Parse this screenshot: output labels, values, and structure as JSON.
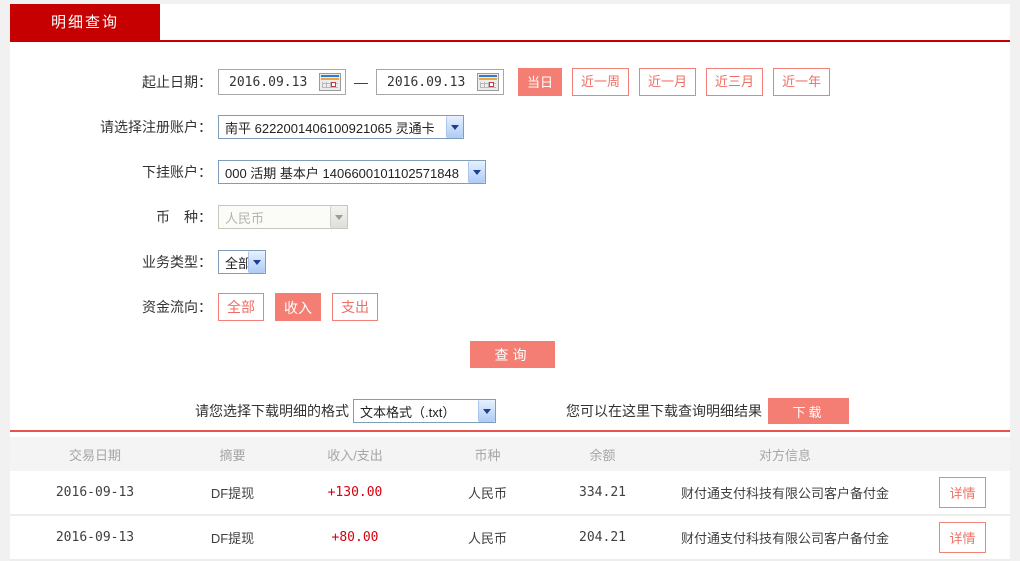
{
  "tab": {
    "label": "明细查询"
  },
  "form": {
    "date_row": {
      "label": "起止日期：",
      "start_date": "2016.09.13",
      "end_date": "2016.09.13",
      "separator": "—",
      "quick_buttons": [
        {
          "label": "当日",
          "active": true
        },
        {
          "label": "近一周",
          "active": false
        },
        {
          "label": "近一月",
          "active": false
        },
        {
          "label": "近三月",
          "active": false
        },
        {
          "label": "近一年",
          "active": false
        }
      ]
    },
    "register_account": {
      "label": "请选择注册账户：",
      "value": "南平 6222001406100921065 灵通卡"
    },
    "linked_account": {
      "label": "下挂账户：",
      "value": "000 活期 基本户 1406600101102571848"
    },
    "currency": {
      "label": "币　种：",
      "value": "人民币",
      "disabled": true
    },
    "business_type": {
      "label": "业务类型：",
      "value": "全部"
    },
    "fund_direction": {
      "label": "资金流向：",
      "options": [
        {
          "label": "全部",
          "active": false
        },
        {
          "label": "收入",
          "active": true
        },
        {
          "label": "支出",
          "active": false
        }
      ]
    },
    "query_button": "查询"
  },
  "download": {
    "format_label": "请您选择下载明细的格式",
    "format_value": "文本格式（.txt）",
    "hint": "您可以在这里下载查询明细结果",
    "button": "下载"
  },
  "table": {
    "headers": [
      "交易日期",
      "摘要",
      "收入/支出",
      "币种",
      "余额",
      "对方信息",
      ""
    ],
    "rows": [
      {
        "date": "2016-09-13",
        "summary": "DF提现",
        "amount": "+130.00",
        "currency": "人民币",
        "balance": "334.21",
        "counterparty": "财付通支付科技有限公司客户备付金",
        "detail": "详情"
      },
      {
        "date": "2016-09-13",
        "summary": "DF提现",
        "amount": "+80.00",
        "currency": "人民币",
        "balance": "204.21",
        "counterparty": "财付通支付科技有限公司客户备付金",
        "detail": "详情"
      }
    ]
  },
  "colors": {
    "brand_red": "#c60001",
    "salmon_fill": "#f47e73",
    "salmon_border": "#f08078",
    "amount_red": "#d7000f",
    "table_divider_red": "#e8544d",
    "page_background": "#f1f1f1"
  }
}
